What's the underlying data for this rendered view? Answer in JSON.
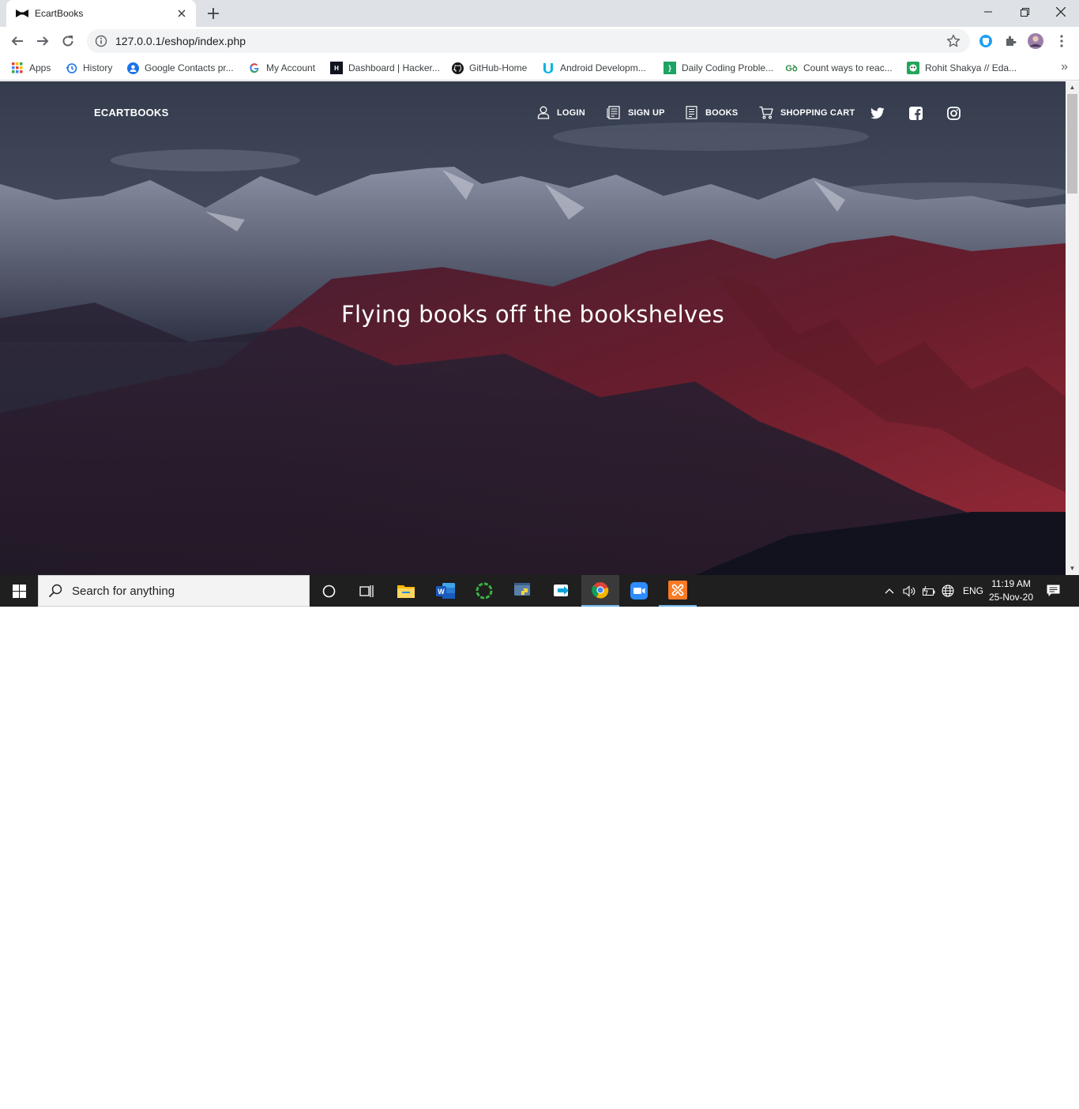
{
  "browser": {
    "tab": {
      "title": "EcartBooks"
    },
    "address": {
      "url": "127.0.0.1/eshop/index.php"
    },
    "bookmarks": [
      {
        "label": "Apps",
        "icon": "apps-grid-icon"
      },
      {
        "label": "History",
        "icon": "history-icon"
      },
      {
        "label": "Google Contacts pr...",
        "icon": "google-contacts-icon"
      },
      {
        "label": "My Account",
        "icon": "google-g-icon"
      },
      {
        "label": "Dashboard | Hacker...",
        "icon": "hackerrank-icon"
      },
      {
        "label": "GitHub-Home",
        "icon": "github-icon"
      },
      {
        "label": "Android Developm...",
        "icon": "udacity-icon"
      },
      {
        "label": "Daily Coding Proble...",
        "icon": "daily-coding-icon"
      },
      {
        "label": "Count ways to reac...",
        "icon": "geeksforgeeks-icon"
      },
      {
        "label": "Rohit Shakya // Eda...",
        "icon": "edabit-icon"
      }
    ],
    "more_bookmarks": "»"
  },
  "site": {
    "brand": "ECARTBOOKS",
    "nav": {
      "login": "LOGIN",
      "signup": "SIGN UP",
      "books": "BOOKS",
      "cart": "SHOPPING CART"
    },
    "headline": "Flying books off the bookshelves",
    "colors": {
      "sky": "#3e4657",
      "mountain_red": "#7a1f2e",
      "mountain_dark": "#1d1f2e"
    }
  },
  "taskbar": {
    "search_placeholder": "Search for anything",
    "language": "ENG",
    "time": "11:19 AM",
    "date": "25-Nov-20",
    "apps": [
      "cortana-icon",
      "task-view-icon",
      "file-explorer-icon",
      "word-icon",
      "green-ring-icon",
      "python-icon",
      "remote-icon",
      "chrome-icon",
      "zoom-icon",
      "xampp-icon"
    ]
  }
}
